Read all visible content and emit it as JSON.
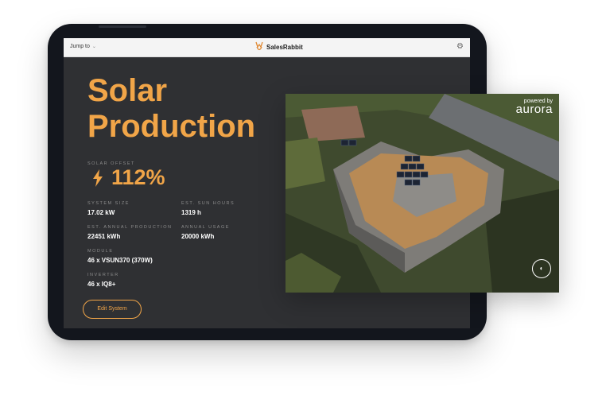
{
  "topbar": {
    "jump_label": "Jump to",
    "brand": "SalesRabbit"
  },
  "title_lines": [
    "Solar",
    "Production"
  ],
  "offset": {
    "label": "SOLAR OFFSET",
    "value": "112%"
  },
  "stats": {
    "system_size": {
      "label": "SYSTEM SIZE",
      "value": "17.02 kW"
    },
    "sun_hours": {
      "label": "EST. SUN HOURS",
      "value": "1319 h"
    },
    "annual_production": {
      "label": "EST. ANNUAL PRODUCTION",
      "value": "22451 kWh"
    },
    "annual_usage": {
      "label": "ANNUAL USAGE",
      "value": "20000 kWh"
    },
    "module": {
      "label": "MODULE",
      "value": "46 x VSUN370 (370W)"
    },
    "inverter": {
      "label": "INVERTER",
      "value": "46 x IQ8+"
    }
  },
  "edit_button": "Edit System",
  "aerial": {
    "powered_by": "powered by",
    "logo": "aurora"
  },
  "colors": {
    "accent": "#f1a548",
    "screen_bg": "#2f3033",
    "bezel": "#13161d"
  }
}
